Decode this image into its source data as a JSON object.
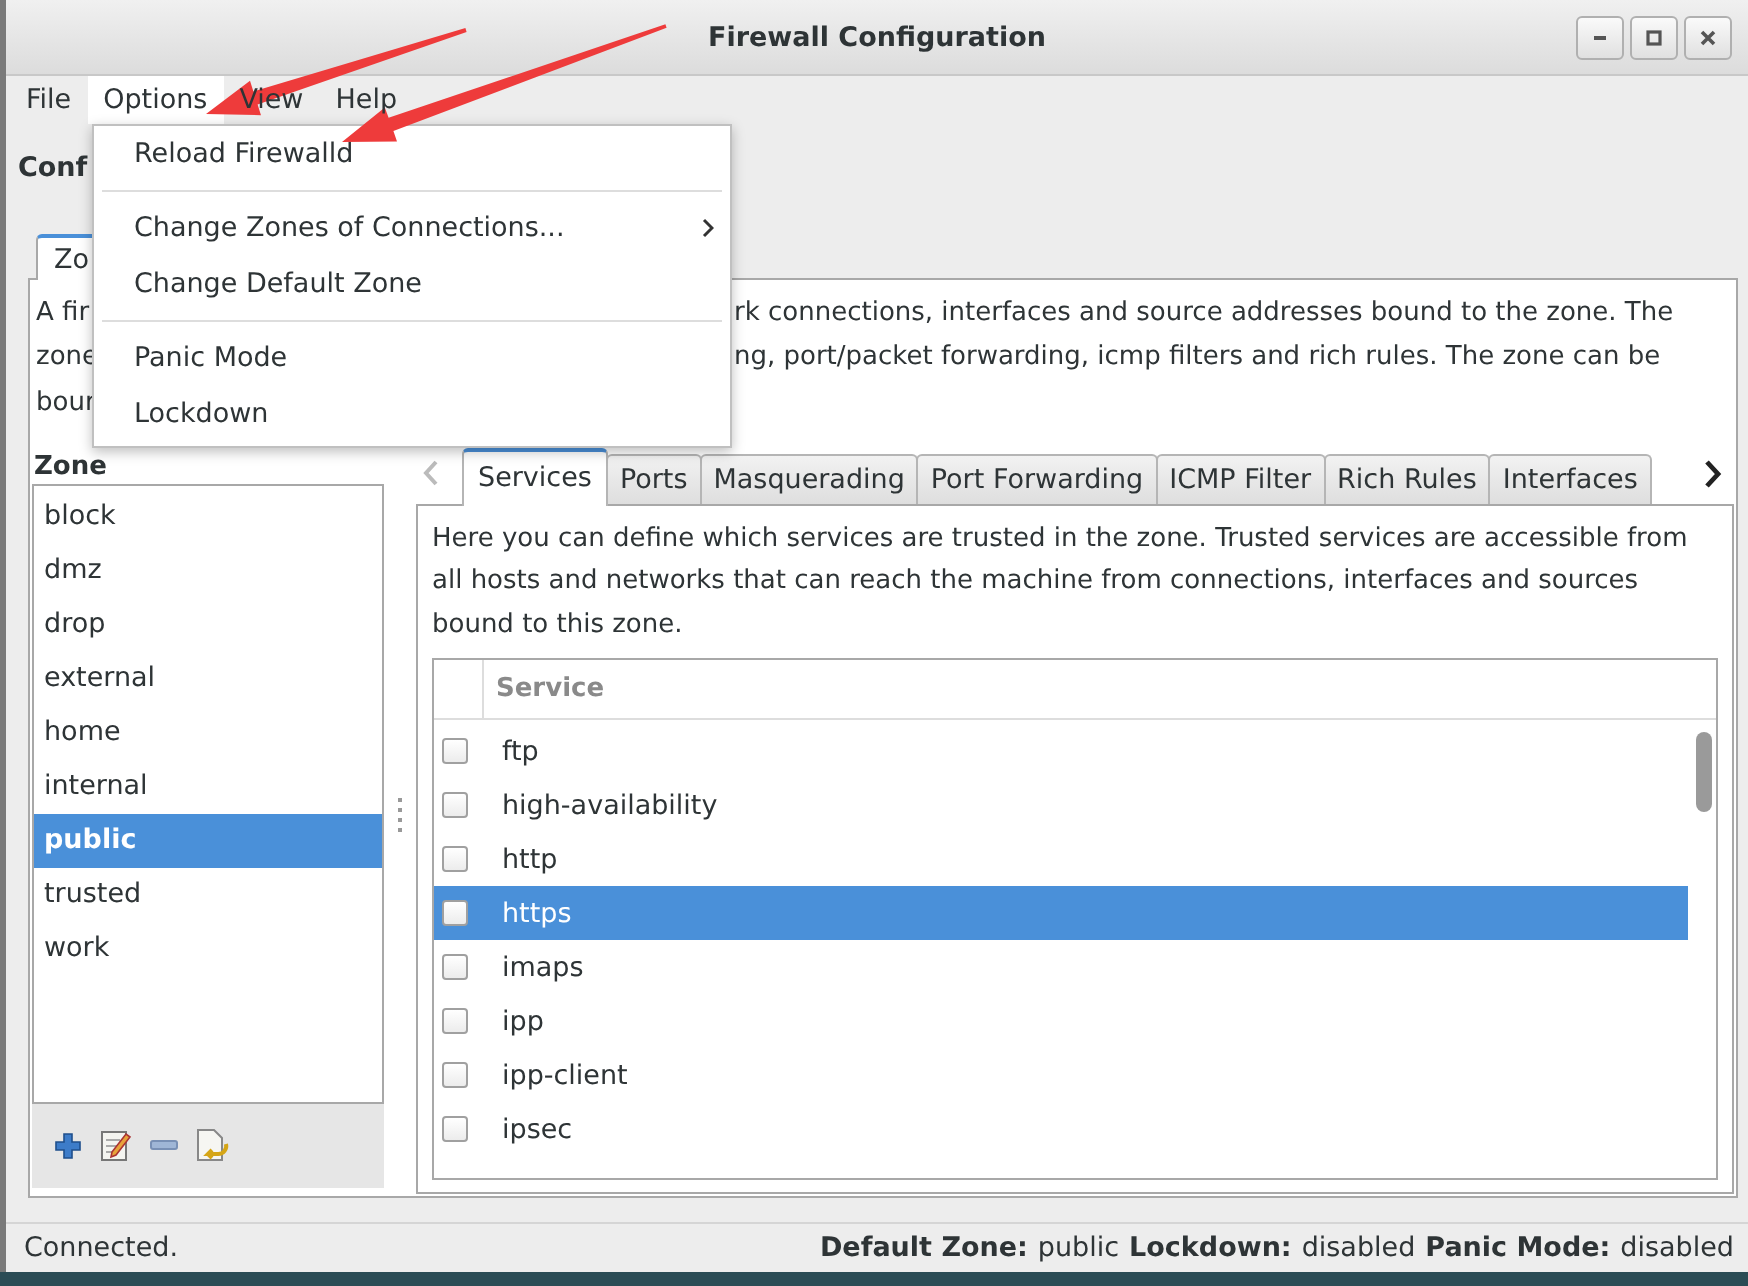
{
  "window": {
    "title": "Firewall Configuration"
  },
  "menubar": [
    {
      "label": "File",
      "selected": false
    },
    {
      "label": "Options",
      "selected": true
    },
    {
      "label": "View",
      "selected": false
    },
    {
      "label": "Help",
      "selected": false
    }
  ],
  "options_menu": [
    {
      "kind": "item",
      "label": "Reload Firewalld"
    },
    {
      "kind": "separator"
    },
    {
      "kind": "submenu",
      "label": "Change Zones of Connections..."
    },
    {
      "kind": "item",
      "label": "Change Default Zone"
    },
    {
      "kind": "separator"
    },
    {
      "kind": "item",
      "label": "Panic Mode"
    },
    {
      "kind": "item",
      "label": "Lockdown"
    }
  ],
  "configuration_label": "Conf",
  "main_tabs": [
    {
      "label": "Zo",
      "selected": true
    }
  ],
  "zone_description": [
    {
      "left": "A fir",
      "right": "rk connections, interfaces and source addresses bound to the zone. The"
    },
    {
      "left": "zone",
      "right": "ng, port/packet forwarding, icmp filters and rich rules. The zone can be"
    },
    {
      "left": "bour"
    }
  ],
  "zone_panel": {
    "label": "Zone",
    "zones": [
      {
        "name": "block",
        "selected": false
      },
      {
        "name": "dmz",
        "selected": false
      },
      {
        "name": "drop",
        "selected": false
      },
      {
        "name": "external",
        "selected": false
      },
      {
        "name": "home",
        "selected": false
      },
      {
        "name": "internal",
        "selected": false
      },
      {
        "name": "public",
        "selected": true
      },
      {
        "name": "trusted",
        "selected": false
      },
      {
        "name": "work",
        "selected": false
      }
    ]
  },
  "zone_tabs": [
    {
      "label": "Services",
      "selected": true
    },
    {
      "label": "Ports",
      "selected": false
    },
    {
      "label": "Masquerading",
      "selected": false
    },
    {
      "label": "Port Forwarding",
      "selected": false
    },
    {
      "label": "ICMP Filter",
      "selected": false
    },
    {
      "label": "Rich Rules",
      "selected": false
    },
    {
      "label": "Interfaces",
      "selected": false
    }
  ],
  "services_description": "Here you can define which services are trusted in the zone. Trusted services are accessible from all hosts and networks that can reach the machine from connections, interfaces and sources bound to this zone.",
  "services_table": {
    "columns": [
      "Service"
    ],
    "rows": [
      {
        "name": "ftp",
        "checked": false,
        "selected": false
      },
      {
        "name": "high-availability",
        "checked": false,
        "selected": false
      },
      {
        "name": "http",
        "checked": false,
        "selected": false
      },
      {
        "name": "https",
        "checked": false,
        "selected": true
      },
      {
        "name": "imaps",
        "checked": false,
        "selected": false
      },
      {
        "name": "ipp",
        "checked": false,
        "selected": false
      },
      {
        "name": "ipp-client",
        "checked": false,
        "selected": false
      },
      {
        "name": "ipsec",
        "checked": false,
        "selected": false
      }
    ]
  },
  "status_bar": {
    "message": "Connected.",
    "fields": [
      {
        "label": "Default Zone:",
        "value": "public"
      },
      {
        "label": "Lockdown:",
        "value": "disabled"
      },
      {
        "label": "Panic Mode:",
        "value": "disabled"
      }
    ]
  }
}
